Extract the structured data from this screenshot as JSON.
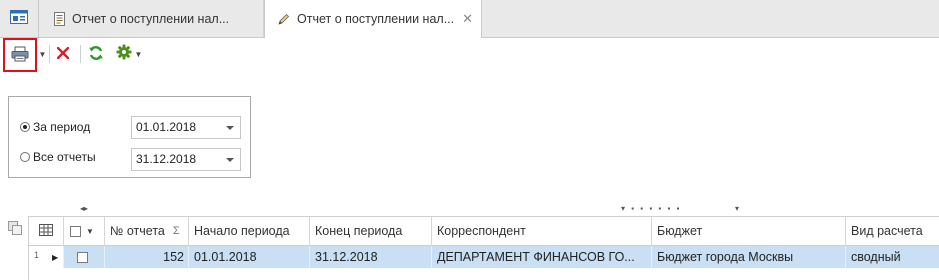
{
  "tabs": [
    {
      "label": "Отчет о поступлении нал...",
      "icon": "document-icon"
    },
    {
      "label": "Отчет о поступлении нал...",
      "icon": "edit-pencil-icon",
      "active": true
    }
  ],
  "tab_close_glyph": "✕",
  "toolbar": {
    "buttons": [
      "print-icon",
      "delete-icon",
      "refresh-icon",
      "settings-icon"
    ],
    "colors": {
      "highlight": "#e0101a",
      "delete": "#d9202a",
      "refresh": "#2e9a2e",
      "settings": "#4f8f1e"
    }
  },
  "filter": {
    "options": [
      {
        "label": "За период",
        "selected": true,
        "date": "01.01.2018"
      },
      {
        "label": "Все отчеты",
        "selected": false,
        "date": "31.12.2018"
      }
    ]
  },
  "grid": {
    "columns": [
      "№ отчета",
      "Начало периода",
      "Конец периода",
      "Корреспондент",
      "Бюджет",
      "Вид расчета"
    ],
    "sort_glyph": "Σ",
    "rows": [
      {
        "index": "1",
        "report_no": "152",
        "start": "01.01.2018",
        "end": "31.12.2018",
        "correspondent": "ДЕПАРТАМЕНТ  ФИНАНСОВ  ГО...",
        "budget": "Бюджет города Москвы",
        "calc_type": "сводный"
      }
    ],
    "selected_row_color": "#c9dff3"
  }
}
